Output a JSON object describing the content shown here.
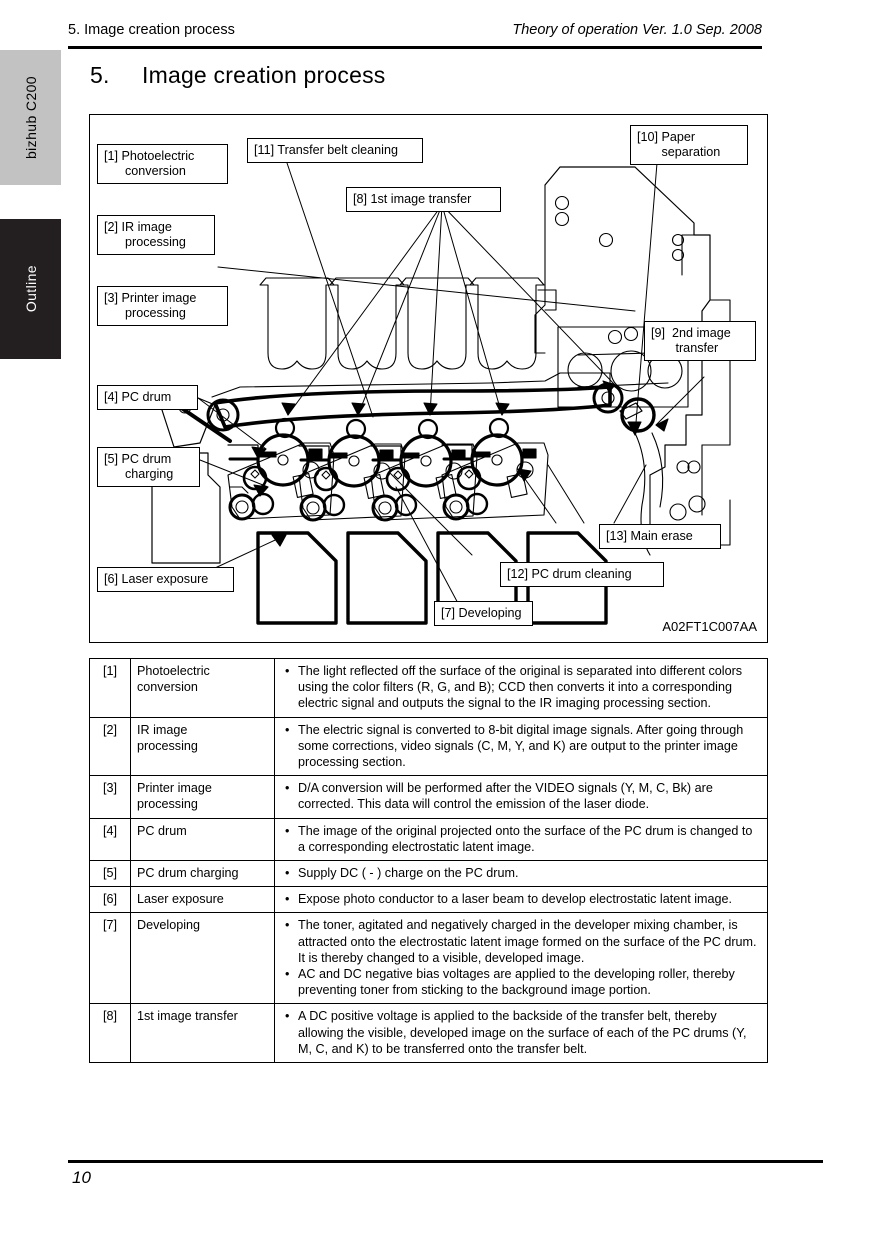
{
  "side_tabs": {
    "product": "bizhub C200",
    "section": "Outline"
  },
  "header": {
    "left": "5. Image creation process",
    "right": "Theory of operation Ver. 1.0 Sep. 2008"
  },
  "chapter": {
    "number": "5.",
    "title": "Image creation process"
  },
  "figure": {
    "id": "A02FT1C007AA",
    "callouts": [
      {
        "key": "c1",
        "text": "[1] Photoelectric\n      conversion"
      },
      {
        "key": "c2",
        "text": "[2] IR image\n      processing"
      },
      {
        "key": "c3",
        "text": "[3] Printer image\n      processing"
      },
      {
        "key": "c4",
        "text": "[4] PC drum"
      },
      {
        "key": "c5",
        "text": "[5] PC drum\n      charging"
      },
      {
        "key": "c6",
        "text": "[6] Laser exposure"
      },
      {
        "key": "c7",
        "text": "[7] Developing"
      },
      {
        "key": "c8",
        "text": "[8] 1st image transfer"
      },
      {
        "key": "c9",
        "text": "[9]  2nd image\n       transfer"
      },
      {
        "key": "c10",
        "text": "[10] Paper\n       separation"
      },
      {
        "key": "c11",
        "text": "[11] Transfer belt cleaning"
      },
      {
        "key": "c12",
        "text": "[12] PC drum cleaning"
      },
      {
        "key": "c13",
        "text": "[13] Main erase"
      }
    ]
  },
  "table": {
    "rows": [
      {
        "num": "[1]",
        "name": "Photoelectric\nconversion",
        "bullets": [
          "The light reflected off the surface of the original is separated into different colors using the color filters (R, G, and B); CCD then converts it into a corresponding electric signal and outputs the signal to the IR imaging processing section."
        ]
      },
      {
        "num": "[2]",
        "name": "IR image\nprocessing",
        "bullets": [
          "The electric signal is converted to 8-bit digital image signals. After going through some corrections, video signals (C, M, Y, and K) are output to the printer image processing section."
        ]
      },
      {
        "num": "[3]",
        "name": "Printer image\nprocessing",
        "bullets": [
          "D/A conversion will be performed after the VIDEO signals (Y, M, C, Bk) are corrected. This data will control the emission of the laser diode."
        ]
      },
      {
        "num": "[4]",
        "name": "PC drum",
        "bullets": [
          "The image of the original projected onto the surface of the PC drum is changed to a corresponding electrostatic latent image."
        ]
      },
      {
        "num": "[5]",
        "name": "PC drum charging",
        "bullets": [
          "Supply DC ( - ) charge on the PC drum."
        ]
      },
      {
        "num": "[6]",
        "name": "Laser exposure",
        "bullets": [
          "Expose photo conductor to a laser beam to develop electrostatic latent image."
        ]
      },
      {
        "num": "[7]",
        "name": "Developing",
        "bullets": [
          "The toner, agitated and negatively charged in the developer mixing chamber, is attracted onto the electrostatic latent image formed on the surface of the PC drum. It is thereby changed to a visible, developed image.",
          "AC and DC negative bias voltages are applied to the developing roller, thereby preventing toner from sticking to the background image portion."
        ]
      },
      {
        "num": "[8]",
        "name": "1st image transfer",
        "bullets": [
          "A DC positive voltage is applied to the backside of the transfer belt, thereby allowing the visible, developed image on the surface of each of the PC drums (Y, M, C, and K) to be transferred onto the transfer belt."
        ]
      }
    ]
  },
  "footer": {
    "page_number": "10"
  }
}
